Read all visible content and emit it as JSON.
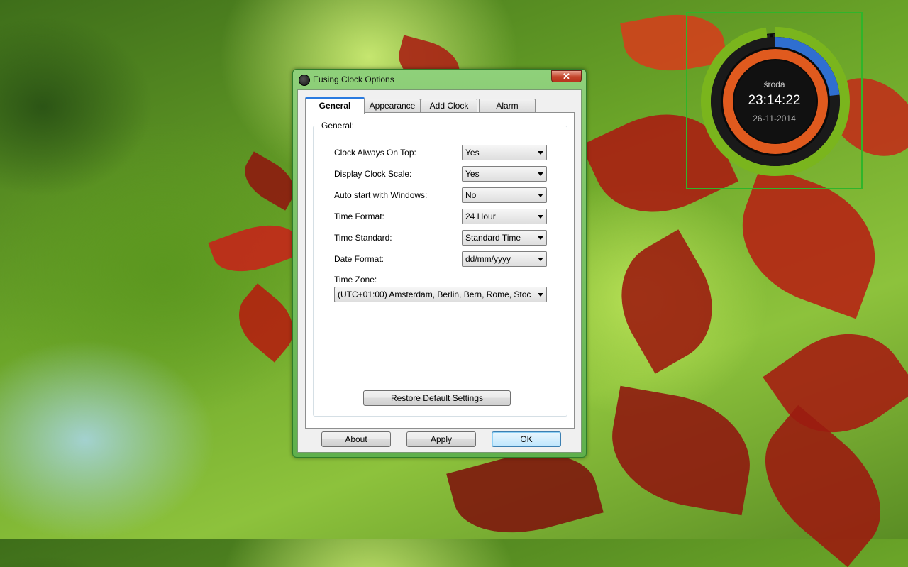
{
  "window": {
    "title": "Eusing Clock Options",
    "close_glyph": "✕"
  },
  "tabs": [
    {
      "label": "General",
      "active": true
    },
    {
      "label": "Appearance",
      "active": false
    },
    {
      "label": "Add Clock",
      "active": false
    },
    {
      "label": "Alarm",
      "active": false
    }
  ],
  "general": {
    "group_label": "General:",
    "settings": [
      {
        "label": "Clock Always On Top:",
        "value": "Yes"
      },
      {
        "label": "Display Clock Scale:",
        "value": "Yes"
      },
      {
        "label": "Auto start with Windows:",
        "value": "No"
      },
      {
        "label": "Time Format:",
        "value": "24 Hour"
      },
      {
        "label": "Time Standard:",
        "value": "Standard Time"
      },
      {
        "label": "Date Format:",
        "value": "dd/mm/yyyy"
      }
    ],
    "time_zone_label": "Time Zone:",
    "time_zone_value": "(UTC+01:00) Amsterdam, Berlin, Bern, Rome, Stoc",
    "restore_label": "Restore Default Settings"
  },
  "footer": {
    "about_label": "About",
    "apply_label": "Apply",
    "ok_label": "OK"
  },
  "clock_widget": {
    "day": "środa",
    "time": "23:14:22",
    "date": "26-11-2014",
    "colors": {
      "hours": "#e05a1e",
      "minutes": "#2f6fd0",
      "seconds": "#7ab51d",
      "frame": "#2fb52a"
    }
  }
}
